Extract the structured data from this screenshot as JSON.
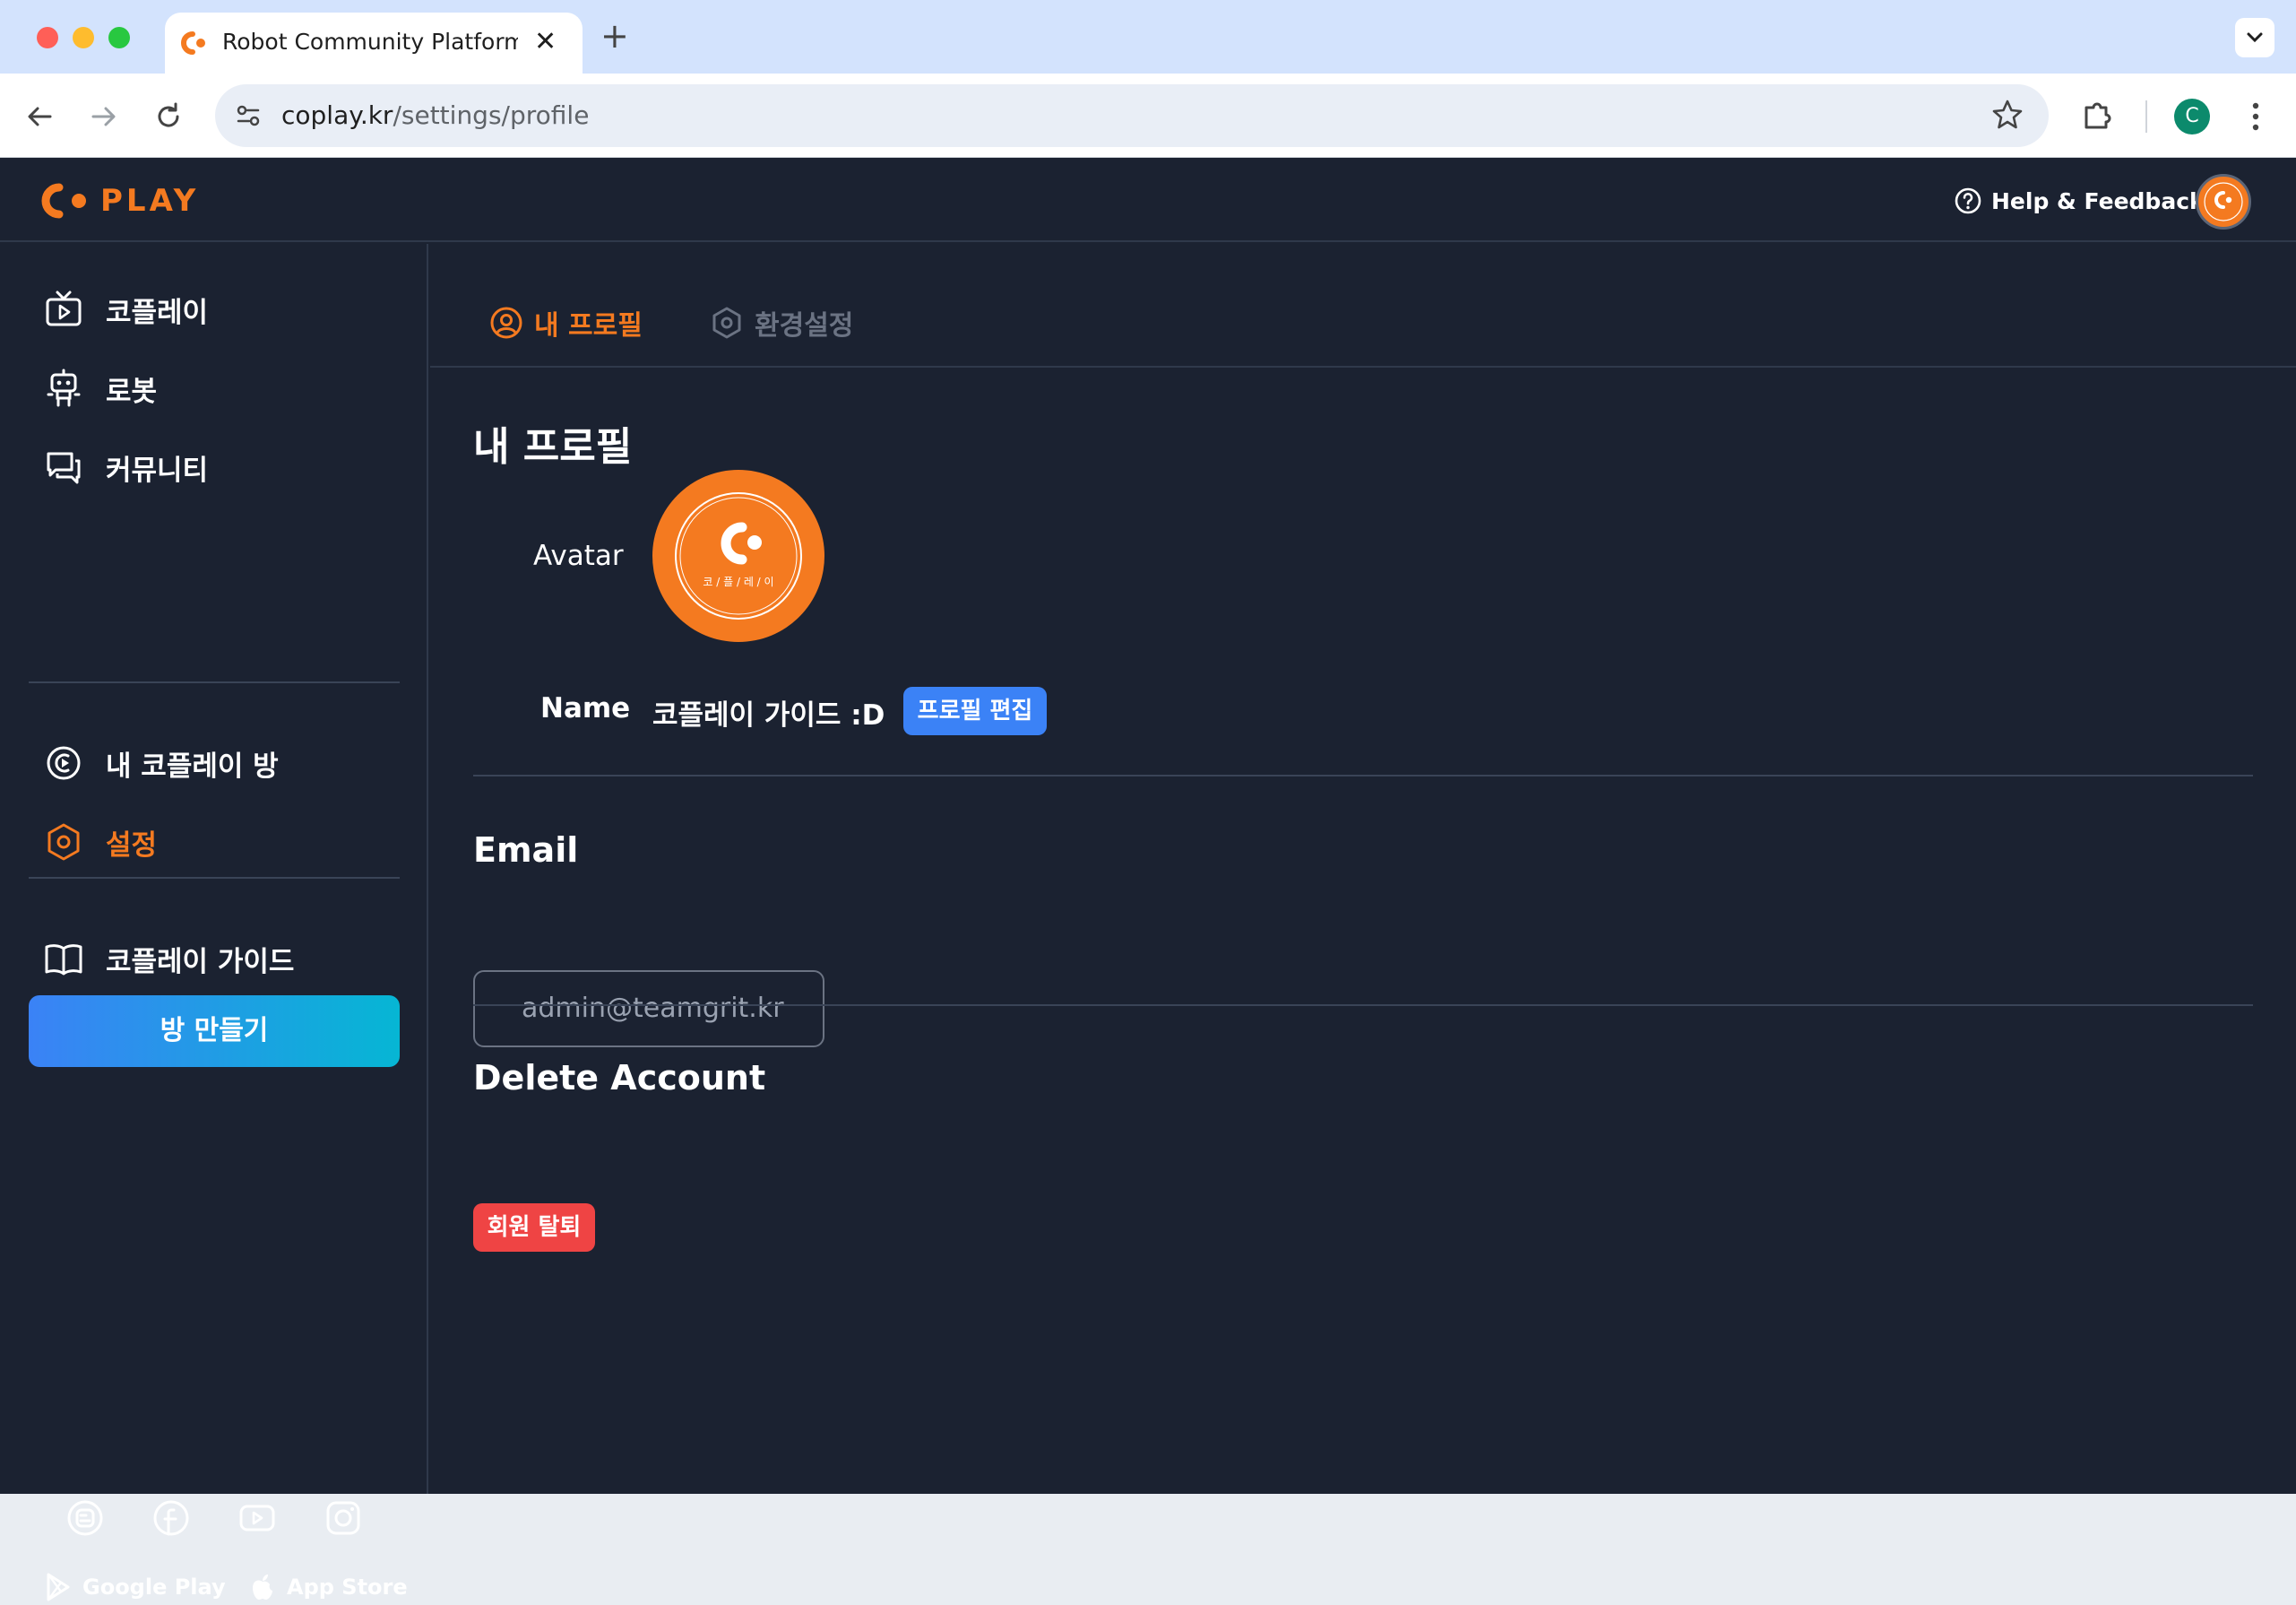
{
  "browser": {
    "tab_title": "Robot Community Platform - C",
    "new_tab_symbol": "+",
    "close_symbol": "✕",
    "url_host": "coplay.kr",
    "url_path": "/settings/profile",
    "profile_initial": "C",
    "profile_color": "#0c8a6c"
  },
  "header": {
    "logo_text": "PLAY",
    "help_label": "Help & Feedback",
    "brand_color": "#f47a20"
  },
  "sidebar": {
    "items": [
      {
        "label": "코플레이",
        "icon": "tv-play-icon"
      },
      {
        "label": "로봇",
        "icon": "robot-icon"
      },
      {
        "label": "커뮤니티",
        "icon": "chat-bubbles-icon"
      },
      {
        "label": "내 코플레이 방",
        "icon": "coplay-room-icon"
      },
      {
        "label": "설정",
        "icon": "gear-icon",
        "active": true
      },
      {
        "label": "코플레이 가이드",
        "icon": "book-icon"
      }
    ],
    "create_room_label": "방 만들기",
    "social": [
      "blog-icon",
      "facebook-icon",
      "youtube-icon",
      "instagram-icon"
    ],
    "stores": {
      "google_play": "Google Play",
      "app_store": "App Store"
    }
  },
  "tabs": [
    {
      "label": "내 프로필",
      "active": true
    },
    {
      "label": "환경설정",
      "active": false
    }
  ],
  "profile": {
    "title": "내 프로필",
    "avatar_label": "Avatar",
    "avatar_caption": "코 / 플 / 레 / 이",
    "name_label": "Name",
    "name_value": "코플레이 가이드 :D",
    "edit_label": "프로필 편집",
    "email_title": "Email",
    "email_value": "admin@teamgrit.kr",
    "delete_title": "Delete Account",
    "delete_label": "회원 탈퇴"
  }
}
